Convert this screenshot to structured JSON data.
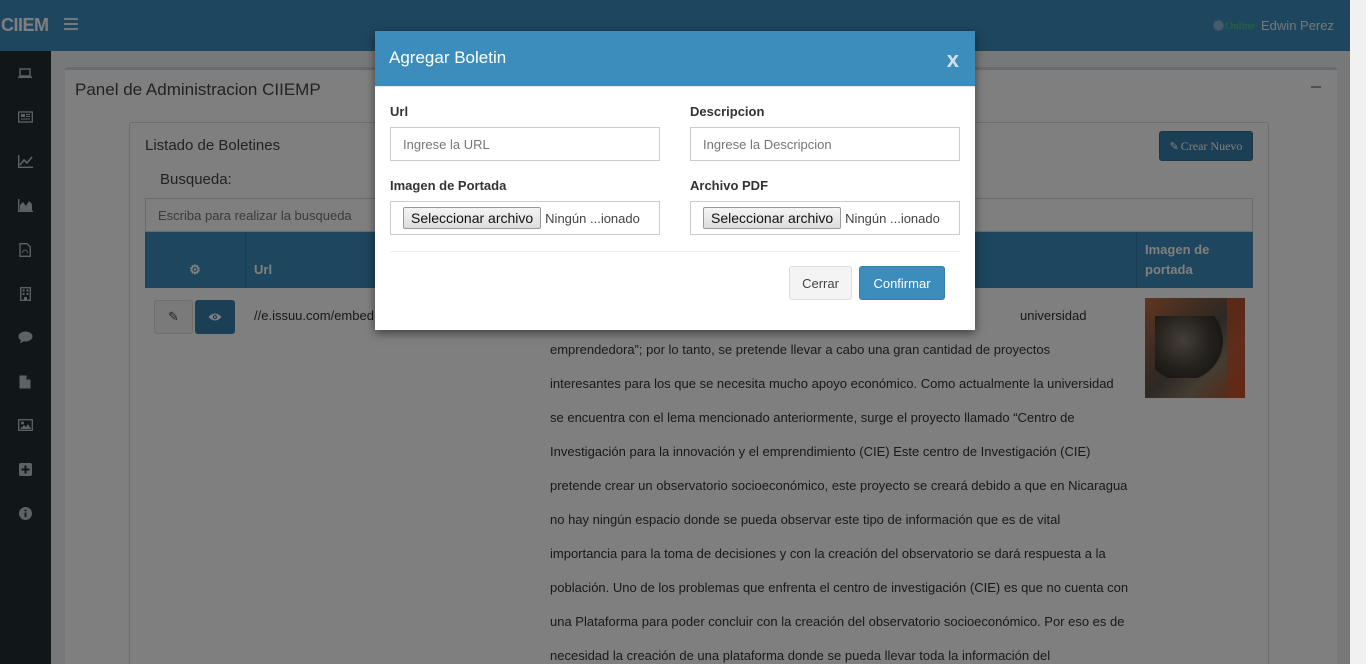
{
  "header": {
    "logo": "CIIEM",
    "status_online": "Online",
    "user_name": "Edwin Perez"
  },
  "sidebar": {
    "icons": [
      "laptop-icon",
      "newspaper-icon",
      "line-chart-icon",
      "area-chart-icon",
      "pdf-file-icon",
      "building-icon",
      "comments-icon",
      "file-icon",
      "image-icon",
      "plus-square-icon",
      "info-circle-icon"
    ]
  },
  "panel": {
    "title": "Panel de Administracion CIIEMP",
    "list_title": "Listado de Boletines",
    "search_label": "Busqueda:",
    "search_placeholder": "Escriba para realizar la busqueda",
    "create_button": "Crear Nuevo",
    "table": {
      "headers": [
        "Url",
        "Imagen de portada"
      ],
      "rows": [
        {
          "url": "//e.issuu.com/embed",
          "description_lines": [
            "universidad",
            "emprendedora”; por lo tanto, se pretende llevar a cabo una gran cantidad de proyectos",
            "interesantes para los que se necesita mucho apoyo económico. Como actualmente la universidad",
            "se encuentra con el lema mencionado anteriormente, surge el proyecto llamado “Centro de",
            "Investigación para la innovación y el emprendimiento (CIE) Este centro de Investigación (CIE)",
            "pretende crear un observatorio socioeconómico, este proyecto se creará debido a que en Nicaragua",
            "no hay ningún espacio donde se pueda observar este tipo de información que es de vital",
            "importancia para la toma de decisiones y con la creación del observatorio se dará respuesta a la",
            "población. Uno de los problemas que enfrenta el centro de investigación (CIE) es que no cuenta con",
            "una Plataforma para poder concluir con la creación del observatorio socioeconómico. Por eso es de",
            "necesidad la creación de una plataforma donde se pueda llevar toda la información del"
          ]
        }
      ]
    }
  },
  "modal": {
    "title": "Agregar Boletin",
    "close": "x",
    "url_label": "Url",
    "url_placeholder": "Ingrese la URL",
    "desc_label": "Descripcion",
    "desc_placeholder": "Ingrese la Descripcion",
    "image_label": "Imagen de Portada",
    "pdf_label": "Archivo PDF",
    "file_button": "Seleccionar archivo",
    "file_none": "Ningún ...ionado",
    "cancel_button": "Cerrar",
    "confirm_button": "Confirmar"
  },
  "colors": {
    "primary": "#3c8dbc",
    "sidebar": "#222d32",
    "online": "#4cd964"
  }
}
